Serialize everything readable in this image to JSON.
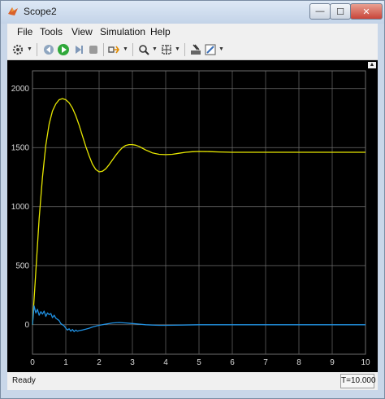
{
  "window": {
    "title": "Scope2",
    "minimize_glyph": "—",
    "maximize_glyph": "☐",
    "close_glyph": "✕"
  },
  "menu": [
    "File",
    "Tools",
    "View",
    "Simulation",
    "Help"
  ],
  "toolbar": {
    "icons": [
      "gear-icon",
      "step-back-icon",
      "run-icon",
      "step-forward-icon",
      "stop-icon",
      "highlight-icon",
      "zoom-icon",
      "autoscale-icon",
      "cursor-icon",
      "style-icon"
    ]
  },
  "status": {
    "ready": "Ready",
    "time": "T=10.000"
  },
  "colors": {
    "yellow_series": "#e6e600",
    "blue_series": "#1f8fe0",
    "grid": "#6e6e6e",
    "axis_text": "#d8d8d8"
  },
  "chart_data": {
    "type": "line",
    "title": "",
    "xlabel": "",
    "ylabel": "",
    "xlim": [
      0,
      10
    ],
    "ylim": [
      -250,
      2150
    ],
    "xticks": [
      0,
      1,
      2,
      3,
      4,
      5,
      6,
      7,
      8,
      9,
      10
    ],
    "yticks": [
      0,
      500,
      1000,
      1500,
      2000
    ],
    "grid": true,
    "series": [
      {
        "color": "#e6e600",
        "x": [
          0,
          0.1,
          0.2,
          0.3,
          0.4,
          0.5,
          0.6,
          0.7,
          0.8,
          0.9,
          1.0,
          1.1,
          1.2,
          1.3,
          1.4,
          1.5,
          1.6,
          1.7,
          1.8,
          1.9,
          2.0,
          2.1,
          2.2,
          2.3,
          2.4,
          2.5,
          2.6,
          2.7,
          2.8,
          2.9,
          3.0,
          3.1,
          3.2,
          3.3,
          3.4,
          3.5,
          3.6,
          3.8,
          4.0,
          4.2,
          4.4,
          4.6,
          4.8,
          5.0,
          5.3,
          5.6,
          6.0,
          6.5,
          7.0,
          8.0,
          9.0,
          10.0
        ],
        "values": [
          0,
          450,
          900,
          1250,
          1520,
          1700,
          1810,
          1870,
          1905,
          1915,
          1905,
          1880,
          1835,
          1770,
          1690,
          1600,
          1510,
          1430,
          1360,
          1315,
          1295,
          1300,
          1320,
          1355,
          1395,
          1435,
          1470,
          1500,
          1518,
          1525,
          1525,
          1520,
          1510,
          1495,
          1480,
          1468,
          1455,
          1443,
          1440,
          1443,
          1452,
          1460,
          1465,
          1467,
          1466,
          1463,
          1460,
          1460,
          1460,
          1460,
          1460,
          1460
        ]
      },
      {
        "color": "#1f8fe0",
        "x": [
          0,
          0.05,
          0.1,
          0.15,
          0.2,
          0.25,
          0.3,
          0.35,
          0.4,
          0.45,
          0.5,
          0.55,
          0.6,
          0.65,
          0.7,
          0.75,
          0.8,
          0.85,
          0.9,
          0.95,
          1.0,
          1.05,
          1.1,
          1.15,
          1.2,
          1.25,
          1.3,
          1.35,
          1.4,
          1.5,
          1.6,
          1.7,
          1.8,
          1.9,
          2.0,
          2.2,
          2.4,
          2.6,
          2.8,
          3.0,
          3.2,
          3.4,
          3.6,
          3.8,
          4.0,
          4.5,
          5.0,
          6.0,
          7.0,
          8.0,
          9.0,
          10.0
        ],
        "values": [
          0,
          160,
          100,
          130,
          80,
          110,
          90,
          115,
          70,
          100,
          85,
          95,
          60,
          80,
          55,
          45,
          35,
          10,
          0,
          -10,
          -30,
          -45,
          -35,
          -55,
          -40,
          -58,
          -45,
          -55,
          -50,
          -45,
          -38,
          -30,
          -20,
          -12,
          -5,
          5,
          15,
          18,
          15,
          10,
          5,
          0,
          -3,
          -5,
          -5,
          -3,
          0,
          0,
          0,
          0,
          0,
          0
        ]
      }
    ]
  }
}
